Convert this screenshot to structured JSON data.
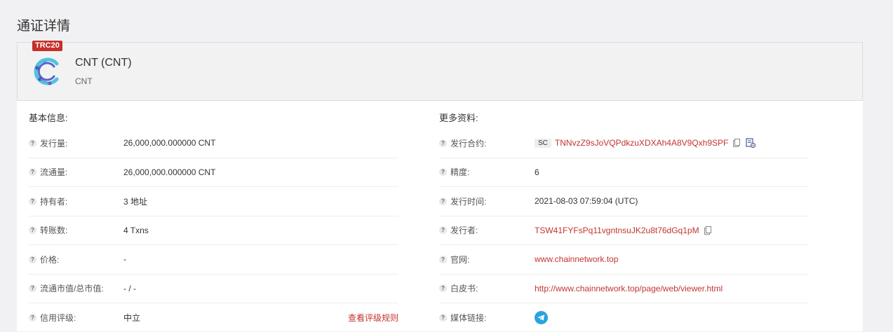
{
  "page": {
    "title": "通证详情"
  },
  "token": {
    "standard_badge": "TRC20",
    "name": "CNT (CNT)",
    "symbol": "CNT"
  },
  "basic_info": {
    "title": "基本信息:",
    "rows": [
      {
        "label": "发行量:",
        "value": "26,000,000.000000 CNT"
      },
      {
        "label": "流通量:",
        "value": "26,000,000.000000 CNT"
      },
      {
        "label": "持有者:",
        "value": "3 地址"
      },
      {
        "label": "转账数:",
        "value": "4 Txns"
      },
      {
        "label": "价格:",
        "value": "-"
      },
      {
        "label": "流通市值/总市值:",
        "value": "- / -"
      },
      {
        "label": "信用评级:",
        "value": "中立",
        "link": "查看评级规则"
      }
    ]
  },
  "more_info": {
    "title": "更多资料:",
    "rows": [
      {
        "label": "发行合约:",
        "tag": "SC",
        "value": "TNNvzZ9sJoVQPdkzuXDXAh4A8V9Qxh9SPF"
      },
      {
        "label": "精度:",
        "value": "6"
      },
      {
        "label": "发行时间:",
        "value": "2021-08-03 07:59:04 (UTC)"
      },
      {
        "label": "发行者:",
        "value": "TSW41FYFsPq11vgntnsuJK2u8t76dGq1pM"
      },
      {
        "label": "官网:",
        "value": "www.chainnetwork.top"
      },
      {
        "label": "白皮书:",
        "value": "http://www.chainnetwork.top/page/web/viewer.html"
      },
      {
        "label": "媒体链接:"
      }
    ]
  },
  "icons": {
    "question": "question-icon",
    "copy": "copy-icon",
    "contract": "contract-verify-icon",
    "telegram": "telegram-icon",
    "logo": "token-logo-icon"
  },
  "colors": {
    "accent_red": "#c23531",
    "badge_red": "#c53028",
    "telegram_blue": "#2aa3e0"
  }
}
